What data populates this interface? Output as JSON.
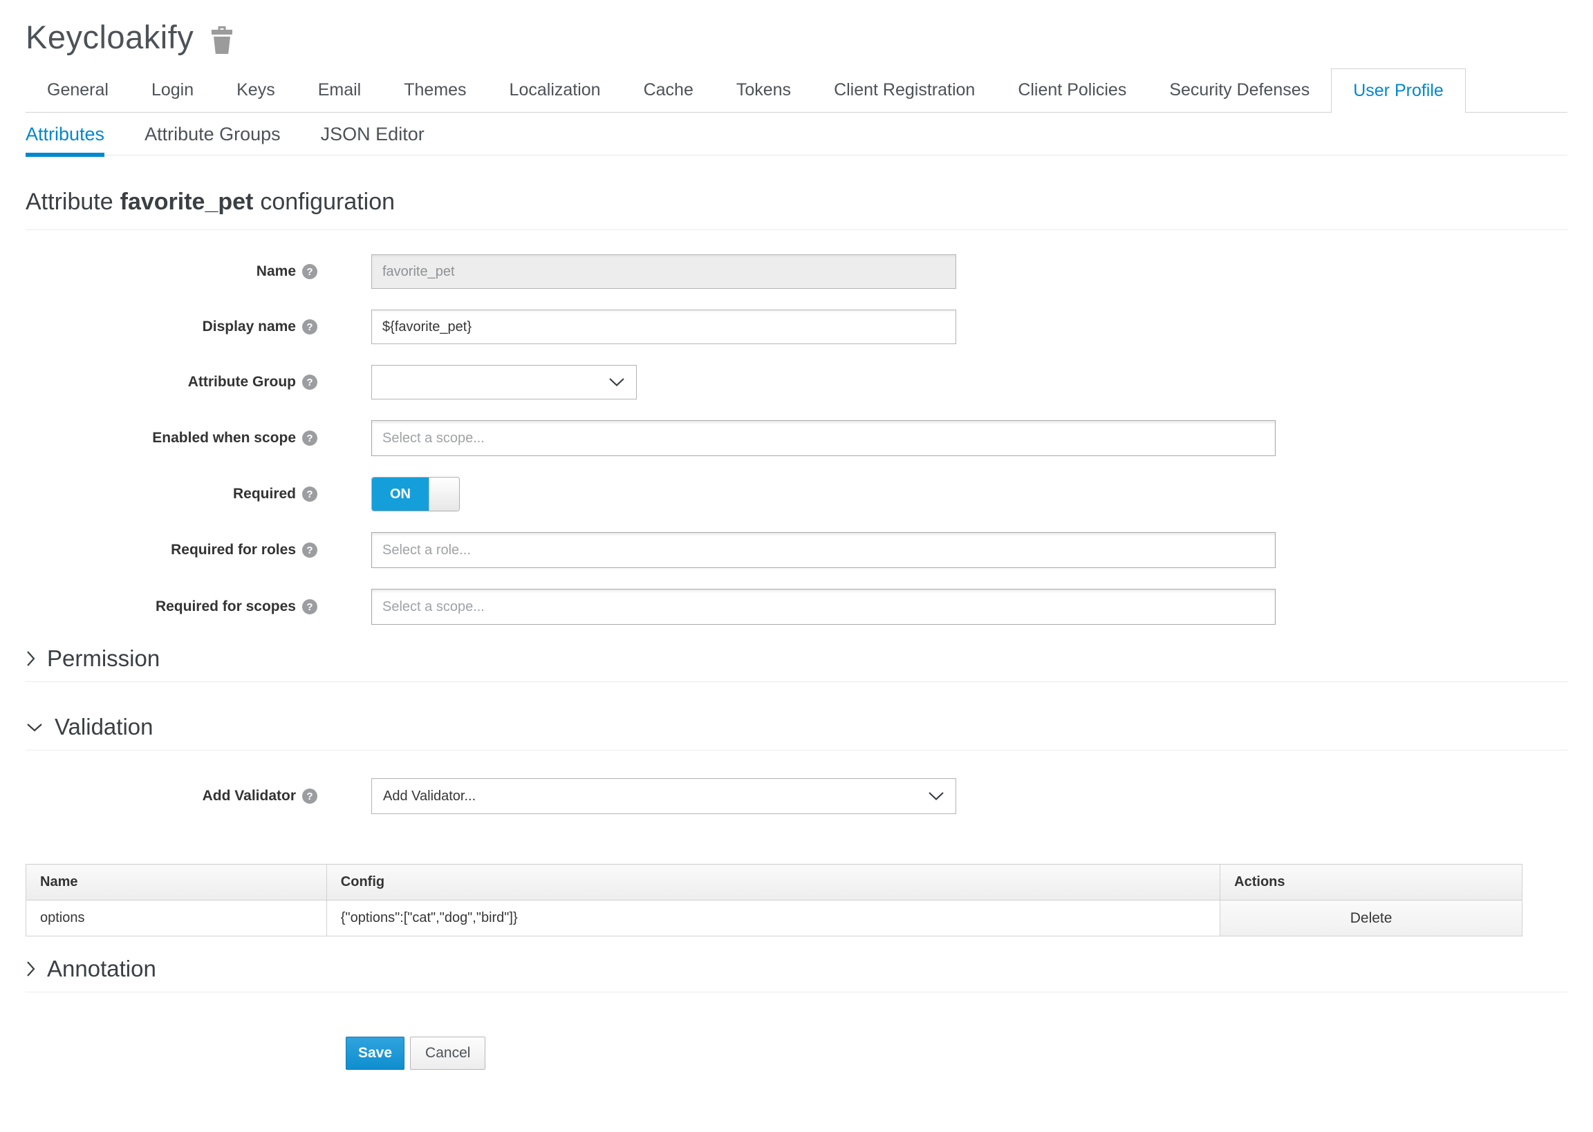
{
  "header": {
    "title": "Keycloakify"
  },
  "icons": {
    "help_glyph": "?",
    "delete": "trash-icon",
    "collapsed": "chevron-right-icon",
    "expanded": "chevron-down-icon",
    "select": "chevron-down-icon"
  },
  "tabs": {
    "items": [
      "General",
      "Login",
      "Keys",
      "Email",
      "Themes",
      "Localization",
      "Cache",
      "Tokens",
      "Client Registration",
      "Client Policies",
      "Security Defenses",
      "User Profile"
    ],
    "active": "User Profile"
  },
  "subtabs": {
    "items": [
      "Attributes",
      "Attribute Groups",
      "JSON Editor"
    ],
    "active": "Attributes"
  },
  "page_heading": {
    "prefix": "Attribute",
    "attribute": "favorite_pet",
    "suffix": "configuration"
  },
  "form": {
    "name": {
      "label": "Name",
      "value": "favorite_pet",
      "disabled": true
    },
    "display_name": {
      "label": "Display name",
      "value": "${favorite_pet}"
    },
    "attribute_group": {
      "label": "Attribute Group",
      "value": ""
    },
    "enabled_when_scope": {
      "label": "Enabled when scope",
      "placeholder": "Select a scope..."
    },
    "required": {
      "label": "Required",
      "state": "ON"
    },
    "required_for_roles": {
      "label": "Required for roles",
      "placeholder": "Select a role..."
    },
    "required_for_scopes": {
      "label": "Required for scopes",
      "placeholder": "Select a scope..."
    }
  },
  "sections": {
    "permission": {
      "label": "Permission",
      "collapsed": true
    },
    "validation": {
      "label": "Validation",
      "collapsed": false
    },
    "annotation": {
      "label": "Annotation",
      "collapsed": true
    }
  },
  "validation": {
    "add_validator": {
      "label": "Add Validator",
      "value": "Add Validator..."
    },
    "table": {
      "headers": [
        "Name",
        "Config",
        "Actions"
      ],
      "rows": [
        {
          "name": "options",
          "config": "{\"options\":[\"cat\",\"dog\",\"bird\"]}",
          "action": "Delete"
        }
      ]
    }
  },
  "buttons": {
    "save": "Save",
    "cancel": "Cancel"
  },
  "colors": {
    "accent": "#0088ce",
    "toggle_on": "#149fda",
    "save_button": "#0f8ecf",
    "tab_text": "#4d5258",
    "disabled_bg": "#ededed"
  }
}
